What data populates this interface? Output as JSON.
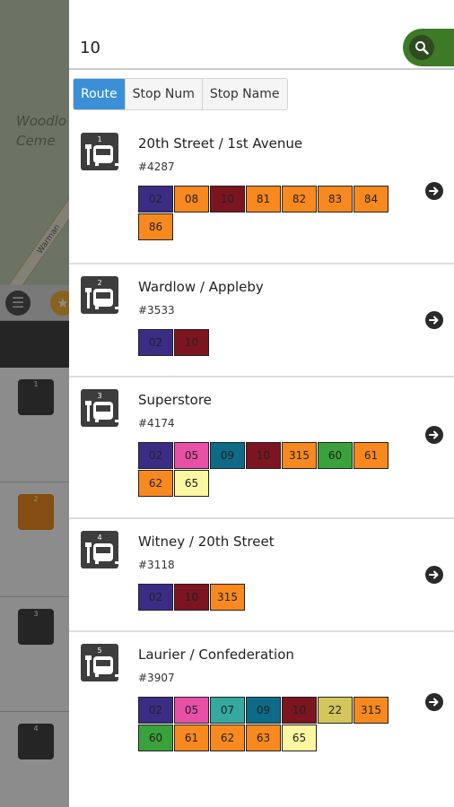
{
  "background": {
    "map_label": "Woodlo Ceme",
    "road_label": "Warman",
    "row_numbers": [
      "1",
      "2",
      "3",
      "4"
    ]
  },
  "search": {
    "value": "10"
  },
  "tabs": [
    {
      "label": "Route",
      "active": true
    },
    {
      "label": "Stop Num",
      "active": false
    },
    {
      "label": "Stop Name",
      "active": false
    }
  ],
  "route_colors": {
    "02": "#3b2d86",
    "05": "#e84fa6",
    "07": "#35a8a0",
    "08": "#f7891f",
    "09": "#0d6b87",
    "10": "#7c1520",
    "22": "#d4c65a",
    "60": "#3aa23a",
    "61": "#f7891f",
    "62": "#f7891f",
    "63": "#f7891f",
    "65": "#fcf7a0",
    "81": "#f7891f",
    "82": "#f7891f",
    "83": "#f7891f",
    "84": "#f7891f",
    "86": "#f7891f",
    "315": "#f7891f"
  },
  "stops": [
    {
      "icon_num": "1",
      "name": "20th Street / 1st Avenue",
      "number": "#4287",
      "routes": [
        "02",
        "08",
        "10",
        "81",
        "82",
        "83",
        "84",
        "86"
      ]
    },
    {
      "icon_num": "2",
      "name": "Wardlow / Appleby",
      "number": "#3533",
      "routes": [
        "02",
        "10"
      ]
    },
    {
      "icon_num": "3",
      "name": "Superstore",
      "number": "#4174",
      "routes": [
        "02",
        "05",
        "09",
        "10",
        "315",
        "60",
        "61",
        "62",
        "65"
      ]
    },
    {
      "icon_num": "4",
      "name": "Witney / 20th Street",
      "number": "#3118",
      "routes": [
        "02",
        "10",
        "315"
      ]
    },
    {
      "icon_num": "5",
      "name": "Laurier / Confederation",
      "number": "#3907",
      "routes": [
        "02",
        "05",
        "07",
        "09",
        "10",
        "22",
        "315",
        "60",
        "61",
        "62",
        "63",
        "65"
      ]
    }
  ]
}
